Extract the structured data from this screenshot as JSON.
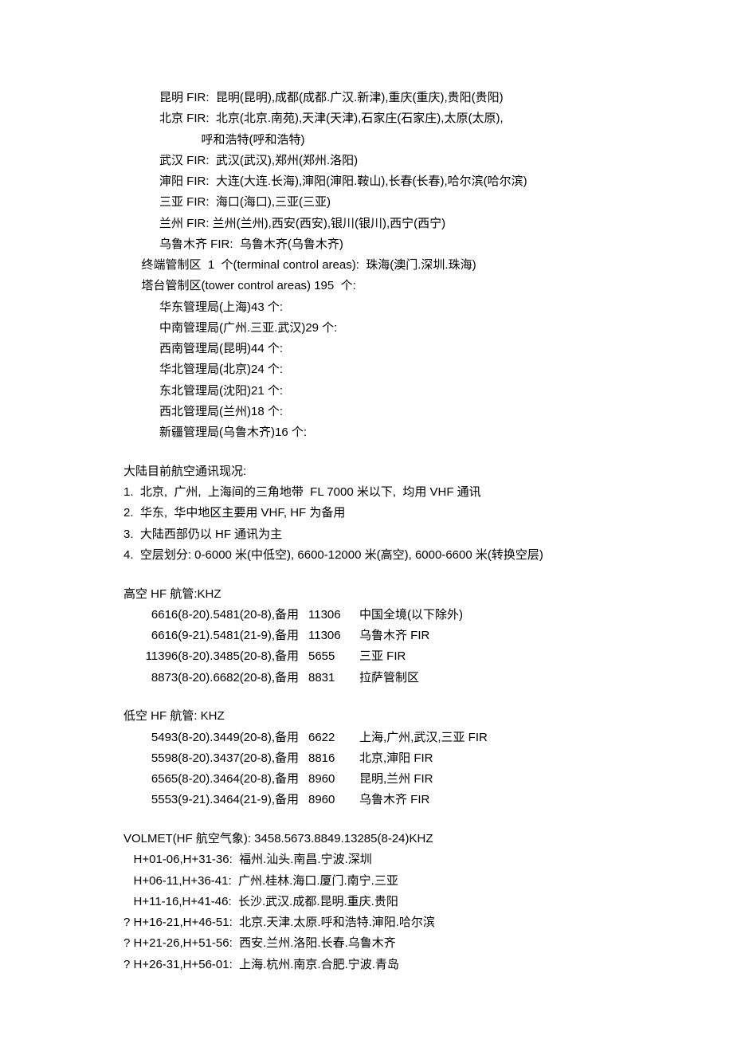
{
  "fir": {
    "kunming": "昆明 FIR:  昆明(昆明),成都(成都.广汉.新津),重庆(重庆),贵阳(贵阳)",
    "beijing_l1": "北京 FIR:  北京(北京.南苑),天津(天津),石家庄(石家庄),太原(太原),",
    "beijing_l2": "呼和浩特(呼和浩特)",
    "wuhan": "武汉 FIR:  武汉(武汉),郑州(郑州.洛阳)",
    "shenyang": "渖阳 FIR:  大连(大连.长海),渖阳(渖阳.鞍山),长春(长春),哈尔滨(哈尔滨)",
    "sanya": "三亚 FIR:  海口(海口),三亚(三亚)",
    "lanzhou": "兰州 FIR: 兰州(兰州),西安(西安),银川(银川),西宁(西宁)",
    "urumqi": "乌鲁木齐 FIR:  乌鲁木齐(乌鲁木齐)"
  },
  "terminal": "终端管制区  1  个(terminal control areas):  珠海(澳门.深圳.珠海)",
  "tower_title": "塔台管制区(tower control areas) 195  个:",
  "tower_items": [
    "华东管理局(上海)43 个:",
    "中南管理局(广州.三亚.武汉)29 个:",
    "西南管理局(昆明)44 个:",
    "华北管理局(北京)24 个:",
    "东北管理局(沈阳)21 个:",
    "西北管理局(兰州)18 个:",
    "新疆管理局(乌鲁木齐)16 个:"
  ],
  "comm_title": "大陆目前航空通讯现况:",
  "comm_items": [
    "1.  北京,  广州,  上海间的三角地带  FL 7000 米以下,  均用 VHF 通讯",
    "2.  华东,  华中地区主要用 VHF, HF 为备用",
    "3.  大陆西部仍以 HF 通讯为主",
    "4.  空层划分: 0-6000 米(中低空), 6600-12000 米(高空), 6000-6600 米(转换空层)"
  ],
  "high_hf_title": "高空 HF 航管:KHZ",
  "high_hf_rows": [
    {
      "c1": "6616(8-20).5481(20-8),备用",
      "c2": "11306",
      "c3": "中国全境(以下除外)"
    },
    {
      "c1": "6616(9-21).5481(21-9),备用",
      "c2": "11306",
      "c3": "乌鲁木齐 FIR"
    },
    {
      "c1": "11396(8-20).3485(20-8),备用",
      "c2": "5655",
      "c3": "三亚 FIR"
    },
    {
      "c1": "8873(8-20).6682(20-8),备用",
      "c2": "8831",
      "c3": "拉萨管制区"
    }
  ],
  "low_hf_title": "低空 HF 航管: KHZ",
  "low_hf_rows": [
    {
      "c1": "5493(8-20).3449(20-8),备用",
      "c2": "6622",
      "c3": "上海,广州,武汉,三亚 FIR"
    },
    {
      "c1": "5598(8-20).3437(20-8),备用",
      "c2": "8816",
      "c3": "北京,渖阳 FIR"
    },
    {
      "c1": "6565(8-20).3464(20-8),备用",
      "c2": "8960",
      "c3": "昆明,兰州 FIR"
    },
    {
      "c1": "5553(9-21).3464(21-9),备用",
      "c2": "8960",
      "c3": "乌鲁木齐 FIR"
    }
  ],
  "volmet_title": "VOLMET(HF 航空气象): 3458.5673.8849.13285(8-24)KHZ",
  "volmet_rows": [
    "   H+01-06,H+31-36:  福州.汕头.南昌.宁波.深圳",
    "   H+06-11,H+36-41:  广州.桂林.海口.厦门.南宁.三亚",
    "   H+11-16,H+41-46:  长沙.武汉.成都.昆明.重庆.贵阳",
    "? H+16-21,H+46-51:  北京.天津.太原.呼和浩特.渖阳.哈尔滨",
    "? H+21-26,H+51-56:  西安.兰州.洛阳.长春.乌鲁木齐",
    "? H+26-31,H+56-01:  上海.杭州.南京.合肥.宁波.青岛"
  ]
}
